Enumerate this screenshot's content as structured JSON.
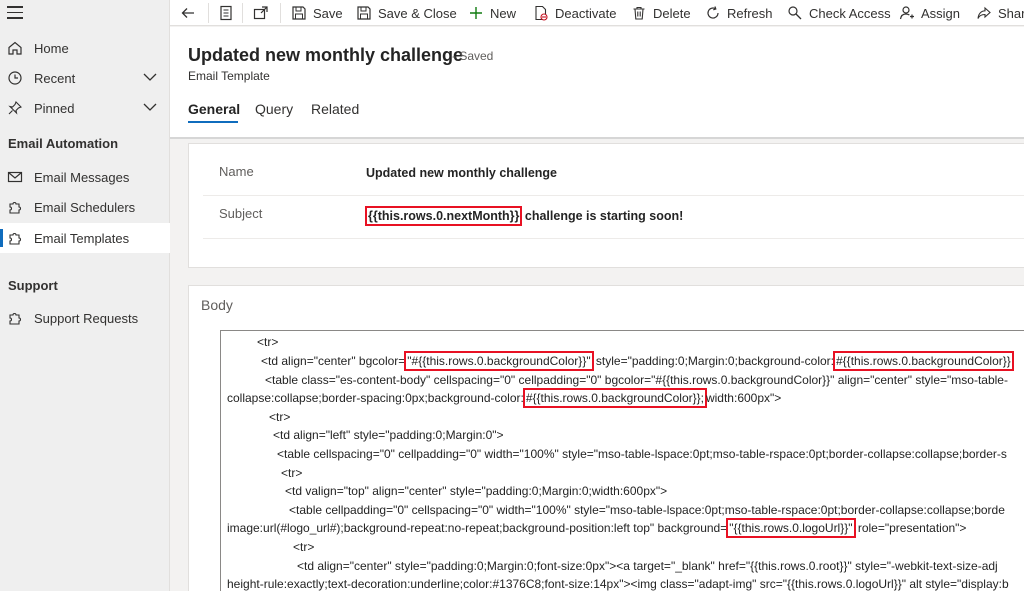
{
  "sidebar": {
    "items": [
      {
        "label": "Home"
      },
      {
        "label": "Recent"
      },
      {
        "label": "Pinned"
      }
    ],
    "groups": [
      {
        "title": "Email Automation",
        "items": [
          {
            "label": "Email Messages"
          },
          {
            "label": "Email Schedulers"
          },
          {
            "label": "Email Templates"
          }
        ]
      },
      {
        "title": "Support",
        "items": [
          {
            "label": "Support Requests"
          }
        ]
      }
    ]
  },
  "toolbar": {
    "save": "Save",
    "save_close": "Save & Close",
    "new": "New",
    "deactivate": "Deactivate",
    "delete": "Delete",
    "refresh": "Refresh",
    "check_access": "Check Access",
    "assign": "Assign",
    "share": "Share"
  },
  "record": {
    "title": "Updated new monthly challenge",
    "save_status": "- Saved",
    "entity": "Email Template"
  },
  "tabs": [
    "General",
    "Query",
    "Related"
  ],
  "fields": {
    "name_label": "Name",
    "name_value": "Updated new monthly challenge",
    "subject_label": "Subject",
    "subject_token": "{{this.rows.0.nextMonth}}",
    "subject_rest": " challenge is starting soon!"
  },
  "body": {
    "label": "Body",
    "lines": [
      [
        "<tr>"
      ],
      [
        "<td align=\"center\" bgcolor=",
        "\"#{{this.rows.0.backgroundColor}}\"",
        " style=\"padding:0;Margin:0;background-color:",
        "#{{this.rows.0.backgroundColor}}"
      ],
      [
        "<table class=\"es-content-body\" cellspacing=\"0\" cellpadding=\"0\" bgcolor=\"#{{this.rows.0.backgroundColor}}\" align=\"center\" style=\"mso-table-"
      ],
      [
        "collapse:collapse;border-spacing:0px;background-color:",
        "#{{this.rows.0.backgroundColor}};",
        "width:600px\">"
      ],
      [
        "<tr>"
      ],
      [
        "<td align=\"left\" style=\"padding:0;Margin:0\">"
      ],
      [
        "<table cellspacing=\"0\" cellpadding=\"0\" width=\"100%\" style=\"mso-table-lspace:0pt;mso-table-rspace:0pt;border-collapse:collapse;border-s"
      ],
      [
        "<tr>"
      ],
      [
        "<td valign=\"top\" align=\"center\" style=\"padding:0;Margin:0;width:600px\">"
      ],
      [
        "<table cellpadding=\"0\" cellspacing=\"0\" width=\"100%\" style=\"mso-table-lspace:0pt;mso-table-rspace:0pt;border-collapse:collapse;borde"
      ],
      [
        "image:url(#logo_url#);background-repeat:no-repeat;background-position:left top\" background=",
        "\"{{this.rows.0.logoUrl}}\"",
        " role=\"presentation\">"
      ],
      [
        "<tr>"
      ],
      [
        "<td align=\"center\" style=\"padding:0;Margin:0;font-size:0px\"><a target=\"_blank\" href=\"{{this.rows.0.root}}\" style=\"-webkit-text-size-adj"
      ],
      [
        "height-rule:exactly;text-decoration:underline;color:#1376C8;font-size:14px\"><img class=\"adapt-img\" src=\"{{this.rows.0.logoUrl}}\" alt style=\"display:b"
      ]
    ]
  }
}
